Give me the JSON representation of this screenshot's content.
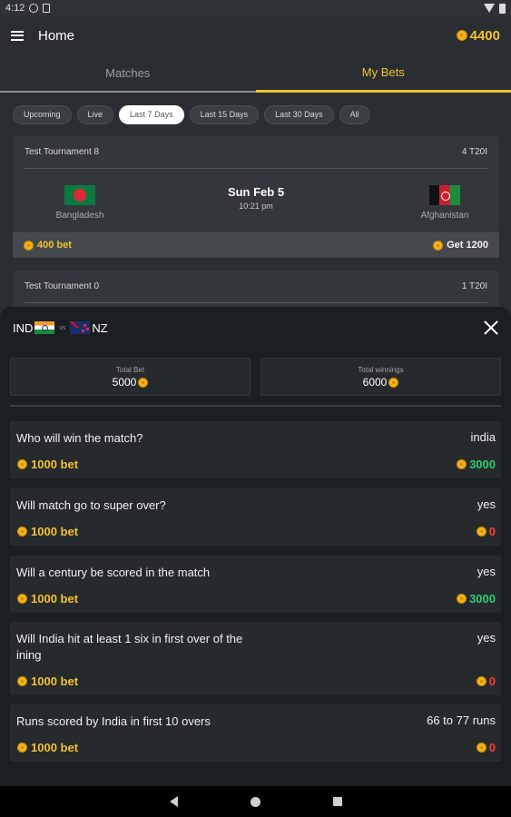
{
  "status_bar": {
    "time": "4:12"
  },
  "app_bar": {
    "title": "Home",
    "coins": "4400"
  },
  "tabs": [
    {
      "label": "Matches"
    },
    {
      "label": "My Bets"
    }
  ],
  "filters": [
    {
      "label": "Upcoming"
    },
    {
      "label": "Live"
    },
    {
      "label": "Last 7 Days"
    },
    {
      "label": "Last 15 Days"
    },
    {
      "label": "Last 30 Days"
    },
    {
      "label": "All"
    }
  ],
  "active_filter": "Last 7 Days",
  "matches": [
    {
      "tournament": "Test Tournament 8",
      "format": "4 T20I",
      "team1": "Bangladesh",
      "team2": "Afghanistan",
      "date": "Sun Feb 5",
      "time": "10:21 pm",
      "bet": "400 bet",
      "get": "Get 1200"
    },
    {
      "tournament": "Test Tournament 0",
      "format": "1 T20I"
    }
  ],
  "sheet": {
    "team1": "IND",
    "vs": "vs",
    "team2": "NZ",
    "total_bet_label": "Total Bet",
    "total_bet": "5000",
    "total_winnings_label": "Total winnings",
    "total_winnings": "6000",
    "bets": [
      {
        "question": "Who will win the match?",
        "answer": "india",
        "stake": "1000 bet",
        "winnings": "3000",
        "won": true
      },
      {
        "question": "Will match go to super over?",
        "answer": "yes",
        "stake": "1000 bet",
        "winnings": "0",
        "won": false
      },
      {
        "question": "Will a century be scored in the match",
        "answer": "yes",
        "stake": "1000 bet",
        "winnings": "3000",
        "won": true
      },
      {
        "question": "Will India hit at least 1 six in first over of the ining",
        "answer": "yes",
        "stake": "1000 bet",
        "winnings": "0",
        "won": false
      },
      {
        "question": "Runs scored by India in first 10 overs",
        "answer": "66 to 77 runs",
        "stake": "1000 bet",
        "winnings": "0",
        "won": false
      }
    ]
  },
  "colors": {
    "accent": "#f2c230",
    "win": "#2ecc71",
    "loss": "#ff3b30"
  }
}
